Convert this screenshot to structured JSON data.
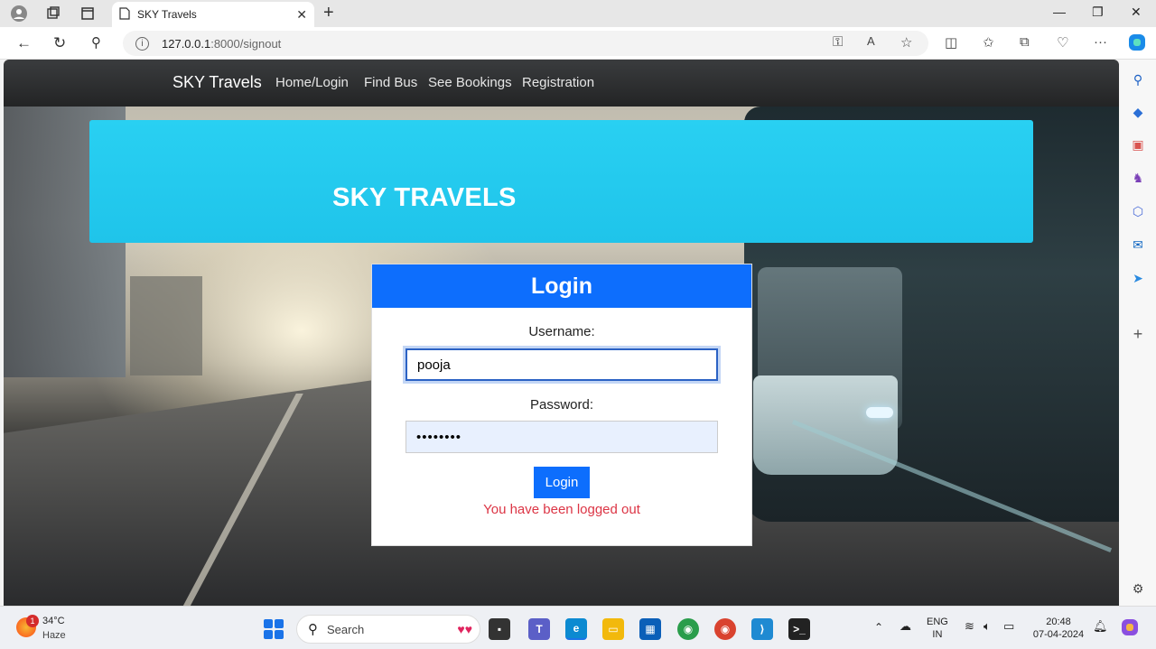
{
  "browser": {
    "tab_title": "SKY Travels",
    "url_host": "127.0.0.1",
    "url_path": ":8000/signout"
  },
  "navbar": {
    "brand": "SKY Travels",
    "links": [
      "Home/Login",
      "Find Bus",
      "See Bookings",
      "Registration"
    ]
  },
  "hero": {
    "title": "SKY TRAVELS"
  },
  "login": {
    "header": "Login",
    "username_label": "Username:",
    "username_value": "pooja",
    "password_label": "Password:",
    "password_value": "••••••••",
    "button_label": "Login",
    "message": "You have been logged out"
  },
  "taskbar": {
    "weather_temp": "34°C",
    "weather_cond": "Haze",
    "notification_count": "1",
    "search_placeholder": "Search",
    "lang_line1": "ENG",
    "lang_line2": "IN",
    "time": "20:48",
    "date": "07-04-2024"
  },
  "colors": {
    "primary": "#0d6efd",
    "hero": "#22c9ee",
    "error": "#dc3545"
  }
}
